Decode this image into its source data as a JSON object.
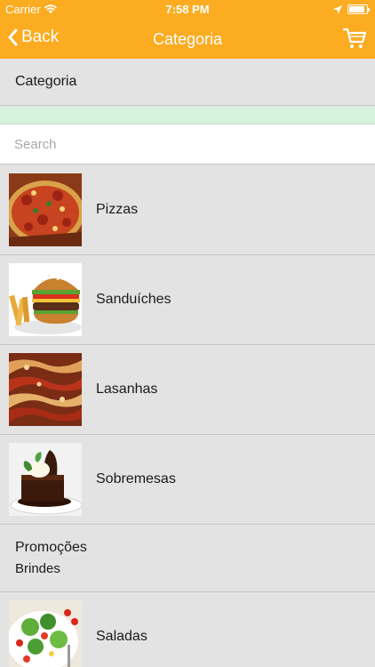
{
  "status": {
    "carrier": "Carrier",
    "time": "7:58 PM"
  },
  "nav": {
    "back_label": "Back",
    "title": "Categoria"
  },
  "header": {
    "label": "Categoria"
  },
  "search": {
    "placeholder": "Search"
  },
  "colors": {
    "accent": "#fbac21",
    "band": "#d6f3dd",
    "background": "#e3e3e3"
  },
  "items": [
    {
      "label": "Pizzas",
      "image": "pizza-thumbnail"
    },
    {
      "label": "Sanduíches",
      "image": "burger-thumbnail"
    },
    {
      "label": "Lasanhas",
      "image": "lasagna-thumbnail"
    },
    {
      "label": "Sobremesas",
      "image": "dessert-thumbnail"
    },
    {
      "label": "Promoções",
      "sublabel": "Brindes"
    },
    {
      "label": "Saladas",
      "image": "salad-thumbnail"
    }
  ]
}
